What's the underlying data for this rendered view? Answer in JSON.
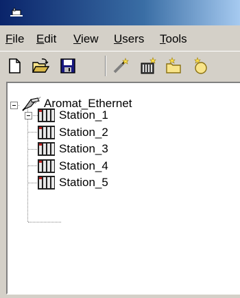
{
  "window": {
    "app_icon": "app-icon"
  },
  "menu": {
    "items": [
      {
        "label_ul": "F",
        "label_rest": "ile"
      },
      {
        "label_ul": "E",
        "label_rest": "dit"
      },
      {
        "label_ul": "V",
        "label_rest": "iew"
      },
      {
        "label_ul": "U",
        "label_rest": "sers"
      },
      {
        "label_ul": "T",
        "label_rest": "ools"
      }
    ]
  },
  "toolbar": {
    "buttons": [
      "new-icon",
      "open-folder-icon",
      "save-icon",
      "wand-icon",
      "add-device-icon",
      "new-folder-icon",
      "new-tag-icon"
    ]
  },
  "tree": {
    "root": {
      "label": "Aromat_Ethernet",
      "icon": "ethernet-channel-icon",
      "expanded": true
    },
    "children": [
      {
        "label": "Station_1",
        "icon": "plc-station-icon",
        "expandable": true
      },
      {
        "label": "Station_2",
        "icon": "plc-station-icon"
      },
      {
        "label": "Station_3",
        "icon": "plc-station-icon"
      },
      {
        "label": "Station_4",
        "icon": "plc-station-icon"
      },
      {
        "label": "Station_5",
        "icon": "plc-station-icon"
      }
    ]
  }
}
